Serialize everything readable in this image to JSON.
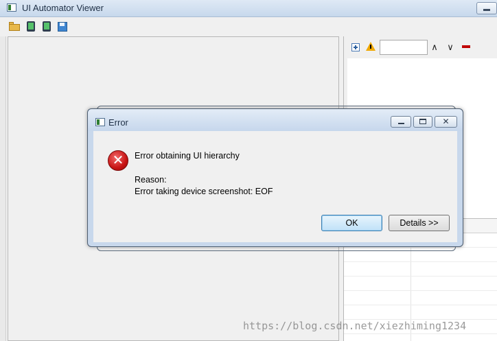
{
  "main_window": {
    "title": "UI Automator Viewer"
  },
  "toolbar": {
    "items": [
      "open-icon",
      "device-screenshot-icon",
      "device-screenshot-compressed-icon",
      "save-icon"
    ]
  },
  "right_panel": {
    "search_value": ""
  },
  "dialog": {
    "title": "Error",
    "message_line1": "Error obtaining UI hierarchy",
    "message_line2": "Reason:",
    "message_line3": "Error taking device screenshot: EOF",
    "ok_label": "OK",
    "details_label": "Details >>",
    "close_glyph": "✕"
  },
  "watermark": "https://blog.csdn.net/xiezhiming1234",
  "colors": {
    "titlebar": "#c7d8ec",
    "error_icon": "#c81414",
    "ok_button_border": "#3c7fb1"
  }
}
